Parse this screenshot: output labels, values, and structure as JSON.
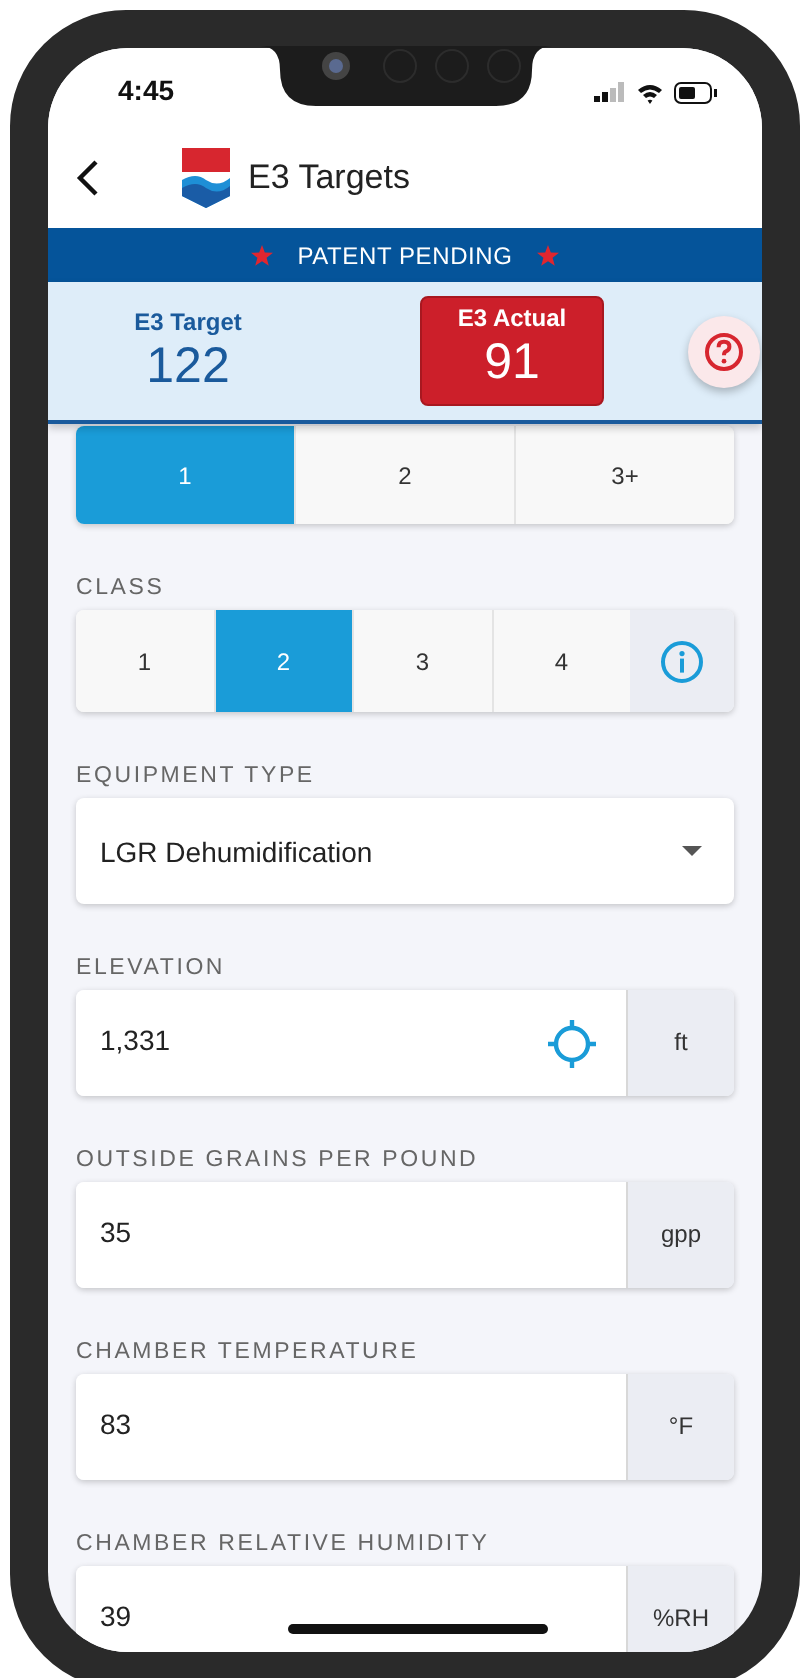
{
  "status_bar": {
    "time": "4:45"
  },
  "header": {
    "title": "E3 Targets"
  },
  "banner": {
    "text": "PATENT PENDING"
  },
  "scores": [
    {
      "label": "E3 Target",
      "value": "122",
      "kind": "target"
    },
    {
      "label": "E3 Actual",
      "value": "91",
      "kind": "actual"
    }
  ],
  "segment": [
    {
      "label": "1",
      "selected": true
    },
    {
      "label": "2",
      "selected": false
    },
    {
      "label": "3+",
      "selected": false
    }
  ],
  "class": {
    "label": "CLASS",
    "options": [
      {
        "label": "1",
        "selected": false
      },
      {
        "label": "2",
        "selected": true
      },
      {
        "label": "3",
        "selected": false
      },
      {
        "label": "4",
        "selected": false
      }
    ]
  },
  "equipment_type": {
    "label": "EQUIPMENT TYPE",
    "value": "LGR Dehumidification"
  },
  "fields": [
    {
      "label": "ELEVATION",
      "value": "1,331",
      "unit": "ft",
      "locate": true
    },
    {
      "label": "OUTSIDE GRAINS PER POUND",
      "value": "35",
      "unit": "gpp",
      "locate": false
    },
    {
      "label": "CHAMBER TEMPERATURE",
      "value": "83",
      "unit": "°F",
      "locate": false
    },
    {
      "label": "CHAMBER RELATIVE HUMIDITY",
      "value": "39",
      "unit": "%RH",
      "locate": false
    }
  ]
}
